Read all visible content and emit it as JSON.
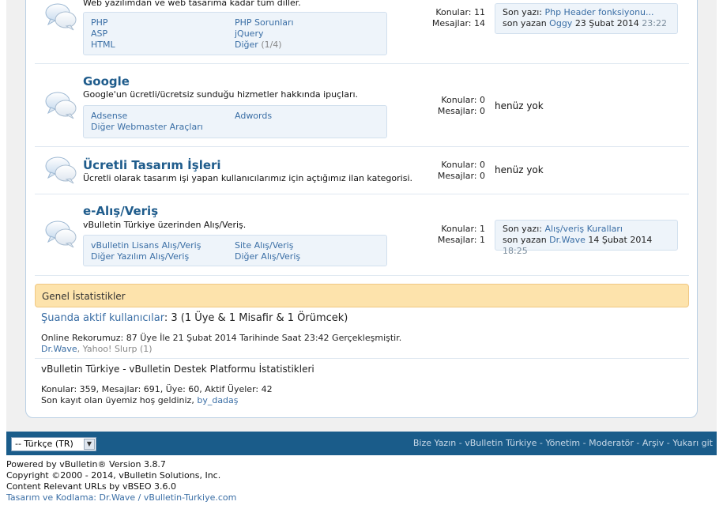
{
  "forums": [
    {
      "title": "",
      "description": "Web yazılımdan ve web tasarıma kadar tüm diller.",
      "subforums": [
        {
          "label": "PHP",
          "count": ""
        },
        {
          "label": "PHP Sorunları",
          "count": ""
        },
        {
          "label": "ASP",
          "count": ""
        },
        {
          "label": "jQuery",
          "count": ""
        },
        {
          "label": "HTML",
          "count": ""
        },
        {
          "label": "Diğer",
          "count": "(1/4)"
        }
      ],
      "stats": {
        "topics_label": "Konular:",
        "topics": "11",
        "posts_label": "Mesajlar:",
        "posts": "14"
      },
      "lastpost": {
        "prefix": "Son yazı:",
        "title": "Php Header fonksiyonu...",
        "by_label": "son yazan",
        "user": "Oggy",
        "date": "23 Şubat 2014",
        "time": "23:22"
      }
    },
    {
      "title": "Google",
      "description": "Google'un ücretli/ücretsiz sunduğu hizmetler hakkında ipuçları.",
      "subforums": [
        {
          "label": "Adsense",
          "count": ""
        },
        {
          "label": "Adwords",
          "count": ""
        },
        {
          "label": "Diğer Webmaster Araçları",
          "count": ""
        }
      ],
      "stats": {
        "topics_label": "Konular:",
        "topics": "0",
        "posts_label": "Mesajlar:",
        "posts": "0"
      },
      "nopost": "henüz yok"
    },
    {
      "title": "Ücretli Tasarım İşleri",
      "description": "Ücretli olarak tasarım işi yapan kullanıcılarımız için açtığımız ilan kategorisi.",
      "stats": {
        "topics_label": "Konular:",
        "topics": "0",
        "posts_label": "Mesajlar:",
        "posts": "0"
      },
      "nopost": "henüz yok"
    },
    {
      "title": "e-Alış/Veriş",
      "description": "vBulletin Türkiye üzerinden Alış/Veriş.",
      "subforums": [
        {
          "label": "vBulletin Lisans Alış/Veriş",
          "count": ""
        },
        {
          "label": "Site Alış/Veriş",
          "count": ""
        },
        {
          "label": "Diğer Yazılım Alış/Veriş",
          "count": ""
        },
        {
          "label": "Diğer Alış/Veriş",
          "count": ""
        }
      ],
      "stats": {
        "topics_label": "Konular:",
        "topics": "1",
        "posts_label": "Mesajlar:",
        "posts": "1"
      },
      "lastpost": {
        "prefix": "Son yazı:",
        "title": "Alış/veriş Kuralları",
        "by_label": "son yazan",
        "user": "Dr.Wave",
        "date": "14 Şubat 2014",
        "time": "18:25"
      }
    }
  ],
  "general_stats": {
    "header": "Genel İstatistikler",
    "active_users_link": "Şuanda aktif kullanıcılar",
    "active_users_text": ": 3 (1 Üye & 1 Misafir & 1 Örümcek)",
    "record_text": "Online Rekorumuz: 87 Üye İle 21 Şubat 2014 Tarihinde Saat 23:42 Gerçekleşmiştir.",
    "online_user": "Dr.Wave",
    "online_bots": ", Yahoo! Slurp (1)",
    "site_stats_title": "vBulletin Türkiye - vBulletin Destek Platformu İstatistikleri",
    "site_stats_text": "Konular: 359, Mesajlar: 691, Üye: 60, Aktif Üyeler: 42",
    "welcome_text": "Son kayıt olan üyemiz hoş geldiniz, ",
    "newest_member": "by_dadaş"
  },
  "footer": {
    "language": "-- Türkçe (TR)",
    "links": [
      "Bize Yazın",
      "vBulletin Türkiye",
      "Yönetim",
      "Moderatör",
      "Arşiv",
      "Yukarı git"
    ],
    "separator": " - "
  },
  "copyright": {
    "line1": "Powered by vBulletin® Version 3.8.7",
    "line2": "Copyright ©2000 - 2014, vBulletin Solutions, Inc.",
    "line3": "Content Relevant URLs by vBSEO 3.6.0",
    "line4_prefix": "Tasarım ve Kodlama: ",
    "line4_link": "Dr.Wave / vBulletin-Turkiye.com"
  },
  "colors": {
    "link": "#3a6ea5",
    "forum_title": "#1f5c8c",
    "header_bg": "#fde3ac",
    "footer_bg": "#1a5c8a"
  }
}
